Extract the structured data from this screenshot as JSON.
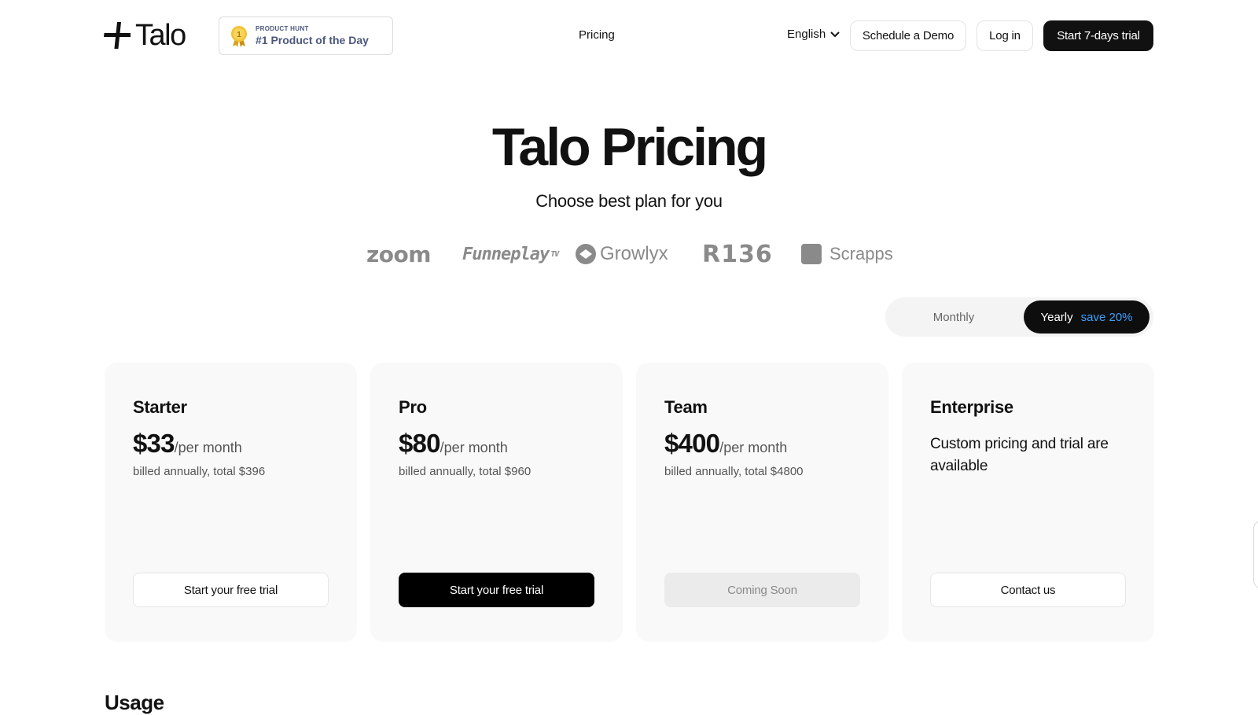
{
  "header": {
    "logo_text": "Talo",
    "badge": {
      "small": "PRODUCT HUNT",
      "big": "#1 Product of the Day",
      "rank": "1"
    },
    "nav_pricing": "Pricing",
    "language": "English",
    "schedule_demo": "Schedule a Demo",
    "login": "Log in",
    "trial": "Start 7-days trial"
  },
  "hero": {
    "title": "Talo Pricing",
    "subtitle": "Choose best plan for you"
  },
  "brands": {
    "zoom": "zoom",
    "funneplay": "Funneplay",
    "funneplay_sup": "TV",
    "growlyx": "Growlyx",
    "r136": "R136",
    "scrapps": "Scrapps"
  },
  "billing_toggle": {
    "monthly": "Monthly",
    "yearly": "Yearly",
    "save": "save 20%",
    "selected": "Yearly"
  },
  "plans": [
    {
      "name": "Starter",
      "price": "$33",
      "per": "/per month",
      "billed": "billed annually, total $396",
      "button": "Start your free trial"
    },
    {
      "name": "Pro",
      "price": "$80",
      "per": "/per month",
      "billed": "billed annually, total $960",
      "button": "Start your free trial"
    },
    {
      "name": "Team",
      "price": "$400",
      "per": "/per month",
      "billed": "billed annually, total $4800",
      "button": "Coming Soon"
    },
    {
      "name": "Enterprise",
      "description": "Custom pricing and trial are available",
      "button": "Contact us"
    }
  ],
  "usage": {
    "heading": "Usage"
  },
  "colors": {
    "accent_blue": "#3aa0ff",
    "primary_black": "#111111",
    "card_bg": "#f9f9f9"
  }
}
